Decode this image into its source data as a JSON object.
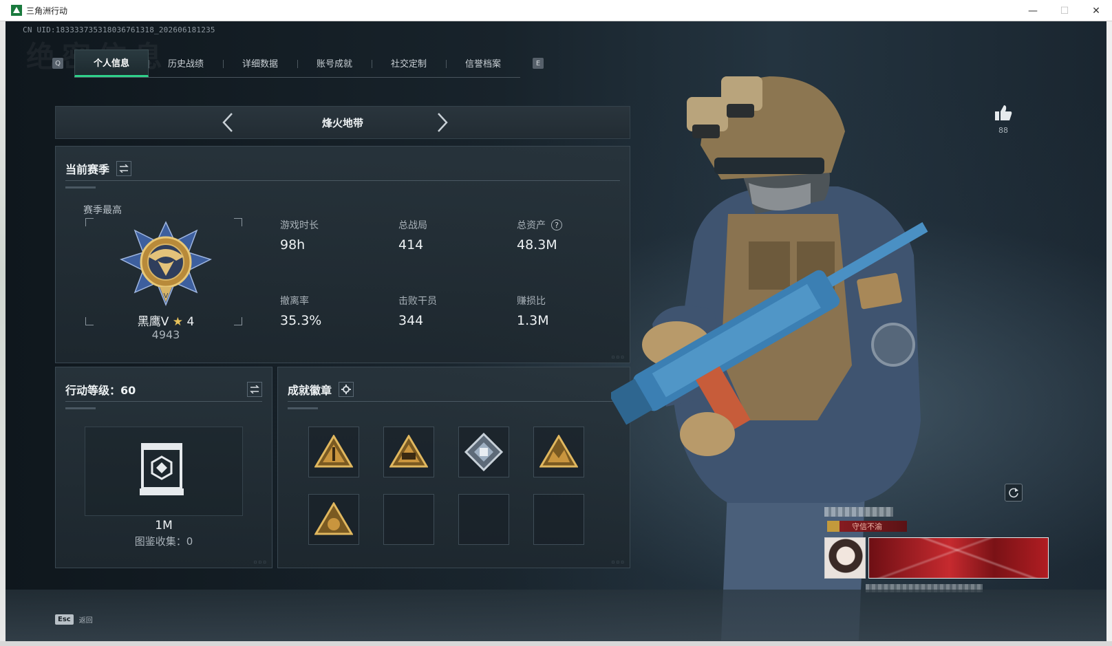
{
  "window": {
    "title": "三角洲行动",
    "minimize_glyph": "—",
    "maximize_glyph": "☐",
    "close_glyph": "✕"
  },
  "header": {
    "uid_text": "CN UID:18333373531803676131​8_202606181235",
    "watermark": "绝密信息"
  },
  "tabs": {
    "left_key": "Q",
    "right_key": "E",
    "items": [
      {
        "label": "个人信息",
        "active": true
      },
      {
        "label": "历史战绩",
        "active": false
      },
      {
        "label": "详细数据",
        "active": false
      },
      {
        "label": "账号成就",
        "active": false
      },
      {
        "label": "社交定制",
        "active": false
      },
      {
        "label": "信誉档案",
        "active": false
      }
    ]
  },
  "mode": {
    "title": "烽火地带",
    "prev_icon": "chevron-left-icon",
    "next_icon": "chevron-right-icon"
  },
  "season": {
    "title": "当前赛季",
    "best_label": "赛季最高",
    "rank_name": "黑鹰V",
    "rank_star": "★",
    "rank_stars": "4",
    "rank_points": "4943",
    "stats": [
      {
        "label": "游戏时长",
        "value": "98h"
      },
      {
        "label": "总战局",
        "value": "414"
      },
      {
        "label": "总资产",
        "value": "48.3M",
        "help": "?"
      },
      {
        "label": "撤离率",
        "value": "35.3%"
      },
      {
        "label": "击败干员",
        "value": "344"
      },
      {
        "label": "赚损比",
        "value": "1.3M"
      }
    ]
  },
  "level": {
    "title": "行动等级：60",
    "value": "1M",
    "collect": "图鉴收集：0"
  },
  "achievements": {
    "title": "成就徽章",
    "slots": [
      "triangle-badge",
      "triangle-badge-58",
      "diamond-badge",
      "triangle-badge",
      "triangle-badge",
      "",
      "",
      ""
    ]
  },
  "side": {
    "like_count": "88",
    "card_tag": "守信不渝"
  },
  "bottom": {
    "esc_key": "Esc",
    "esc_label": "返回"
  },
  "colors": {
    "accent": "#2fd18a",
    "rank_gold": "#e7c25a",
    "card_red": "#c62a2f"
  }
}
